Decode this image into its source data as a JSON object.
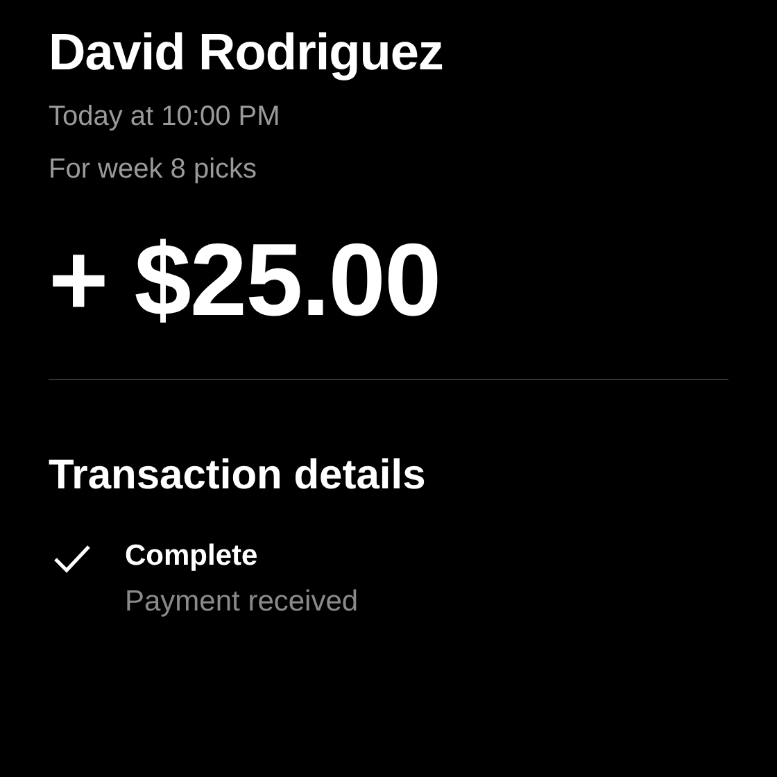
{
  "header": {
    "name": "David Rodriguez",
    "timestamp": "Today at 10:00 PM",
    "note": "For week 8 picks"
  },
  "amount": "+ $25.00",
  "details": {
    "title": "Transaction details",
    "items": [
      {
        "kind": "check",
        "title": "Complete",
        "subtitle": "Payment received"
      }
    ]
  }
}
